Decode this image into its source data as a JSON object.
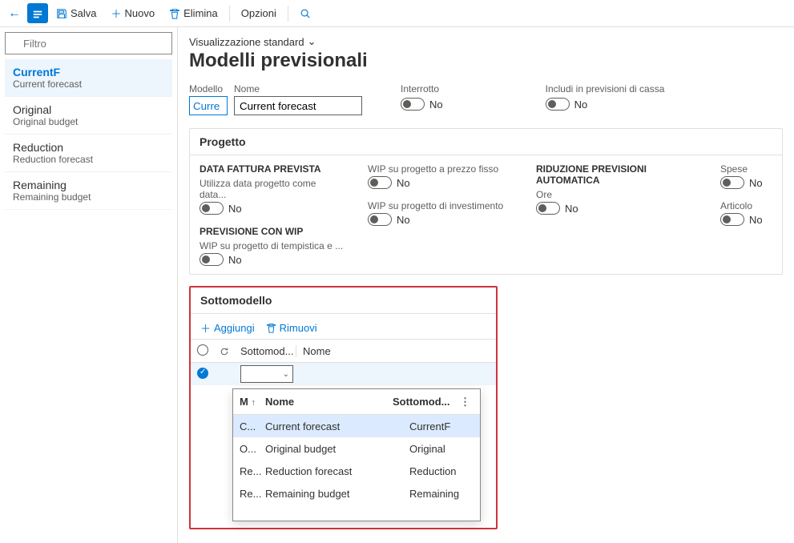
{
  "toolbar": {
    "save": "Salva",
    "new": "Nuovo",
    "delete": "Elimina",
    "options": "Opzioni"
  },
  "sidebar": {
    "filter_placeholder": "Filtro",
    "items": [
      {
        "title": "CurrentF",
        "sub": "Current forecast"
      },
      {
        "title": "Original",
        "sub": "Original budget"
      },
      {
        "title": "Reduction",
        "sub": "Reduction forecast"
      },
      {
        "title": "Remaining",
        "sub": "Remaining budget"
      }
    ]
  },
  "content": {
    "view_label": "Visualizzazione standard",
    "page_title": "Modelli previsionali",
    "fields": {
      "modello_label": "Modello",
      "modello_value": "Curre",
      "nome_label": "Nome",
      "nome_value": "Current forecast",
      "interrotto_label": "Interrotto",
      "interrotto_value": "No",
      "includi_label": "Includi in previsioni di cassa",
      "includi_value": "No"
    },
    "progetto": {
      "header": "Progetto",
      "col1": {
        "h1": "DATA FATTURA PREVISTA",
        "s1": "Utilizza data progetto come data...",
        "v1": "No",
        "h2": "PREVISIONE CON WIP",
        "s2": "WIP su progetto di tempistica e ...",
        "v2": "No"
      },
      "col2": {
        "s1": "WIP su progetto a prezzo fisso",
        "v1": "No",
        "s2": "WIP su progetto di investimento",
        "v2": "No"
      },
      "col3": {
        "h1": "RIDUZIONE PREVISIONI AUTOMATICA",
        "s1": "Ore",
        "v1": "No"
      },
      "col4": {
        "s1": "Spese",
        "v1": "No",
        "s2": "Articolo",
        "v2": "No"
      }
    },
    "sotto": {
      "header": "Sottomodello",
      "add": "Aggiungi",
      "remove": "Rimuovi",
      "col_sotto": "Sottomod...",
      "col_nome": "Nome",
      "dd_col_m": "M",
      "dd_col_nome": "Nome",
      "dd_col_sotto": "Sottomod...",
      "dd_rows": [
        {
          "m": "C...",
          "nome": "Current forecast",
          "sotto": "CurrentF"
        },
        {
          "m": "O...",
          "nome": "Original budget",
          "sotto": "Original"
        },
        {
          "m": "Re...",
          "nome": "Reduction forecast",
          "sotto": "Reduction"
        },
        {
          "m": "Re...",
          "nome": "Remaining budget",
          "sotto": "Remaining"
        }
      ]
    }
  }
}
